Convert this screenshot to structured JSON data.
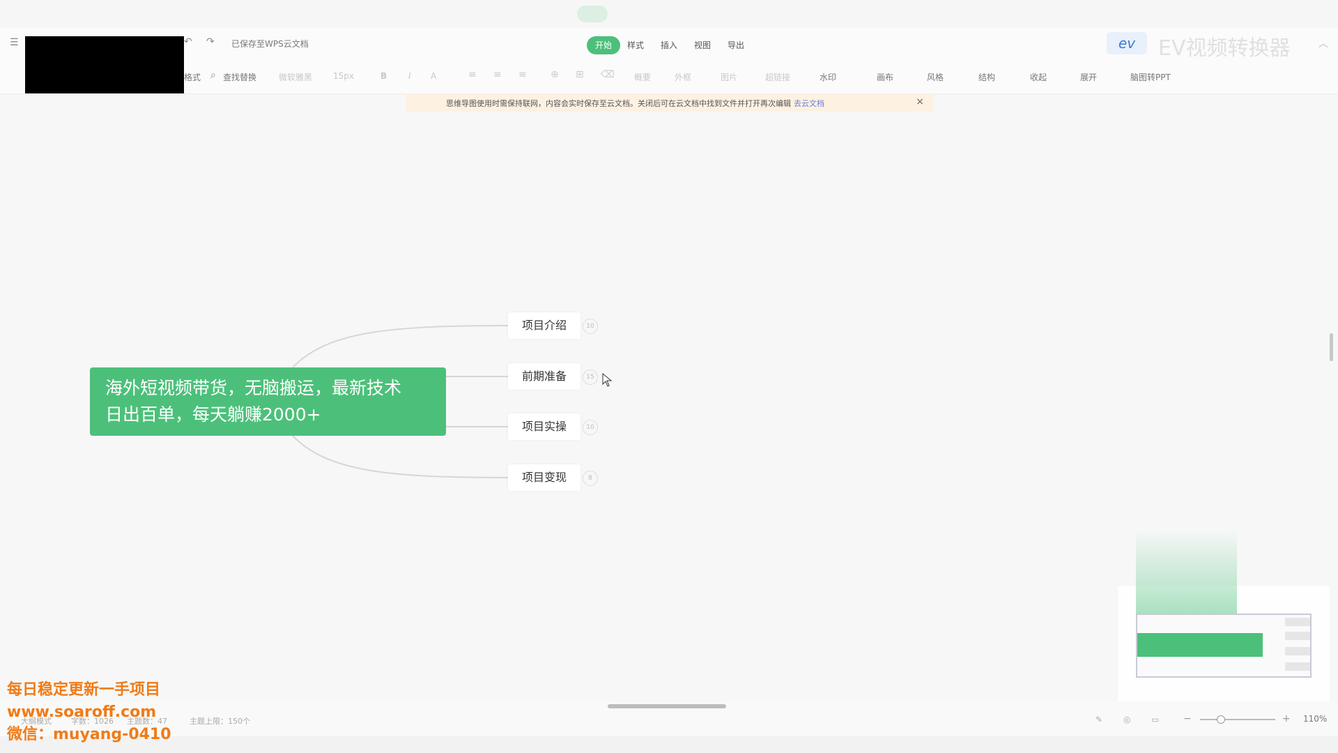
{
  "colors": {
    "accent": "#4cc07a",
    "watermark": "#f07b16",
    "notice_bg": "#fdf1e2",
    "link": "#6b7bd9"
  },
  "titlebar": {
    "save_status": "已保存至WPS云文档"
  },
  "menu": {
    "tabs": [
      "开始",
      "样式",
      "插入",
      "视图",
      "导出"
    ]
  },
  "toolbar": {
    "format_painter": "格式",
    "find_replace": "查找替换",
    "font_name": "微软雅黑",
    "font_size": "15px",
    "bold": "B",
    "italic": "I",
    "font_color": "A",
    "outline": "概要",
    "frame": "外框",
    "image": "图片",
    "hyperlink": "超链接",
    "watermark": "水印",
    "canvas": "画布",
    "style": "风格",
    "structure": "结构",
    "collapse": "收起",
    "expand": "展开",
    "to_ppt": "脑图转PPT"
  },
  "ev_overlay": {
    "badge": "ev",
    "text": "EV视频转换器"
  },
  "notice": {
    "text": "思维导图使用时需保持联网，内容会实时保存至云文档。关闭后可在云文档中找到文件并打开再次编辑",
    "link": "去云文档",
    "close": "×"
  },
  "mindmap": {
    "root": {
      "line1": "海外短视频带货，无脑搬运，最新技术",
      "line2": "日出百单，每天躺赚2000+"
    },
    "branches": [
      {
        "label": "项目介绍",
        "count": "10"
      },
      {
        "label": "前期准备",
        "count": "15"
      },
      {
        "label": "项目实操",
        "count": "10"
      },
      {
        "label": "项目变现",
        "count": "8"
      }
    ]
  },
  "status": {
    "mode": "大纲模式",
    "words": "字数：1026",
    "nodes": "主题数：47",
    "topic_limit": "主题上限：150个",
    "zoom_minus": "−",
    "zoom_plus": "+",
    "zoom": "110%"
  },
  "watermark": {
    "line1": "每日稳定更新一手项目",
    "line2": "www.soaroff.com",
    "line3": "微信：muyang-0410"
  }
}
